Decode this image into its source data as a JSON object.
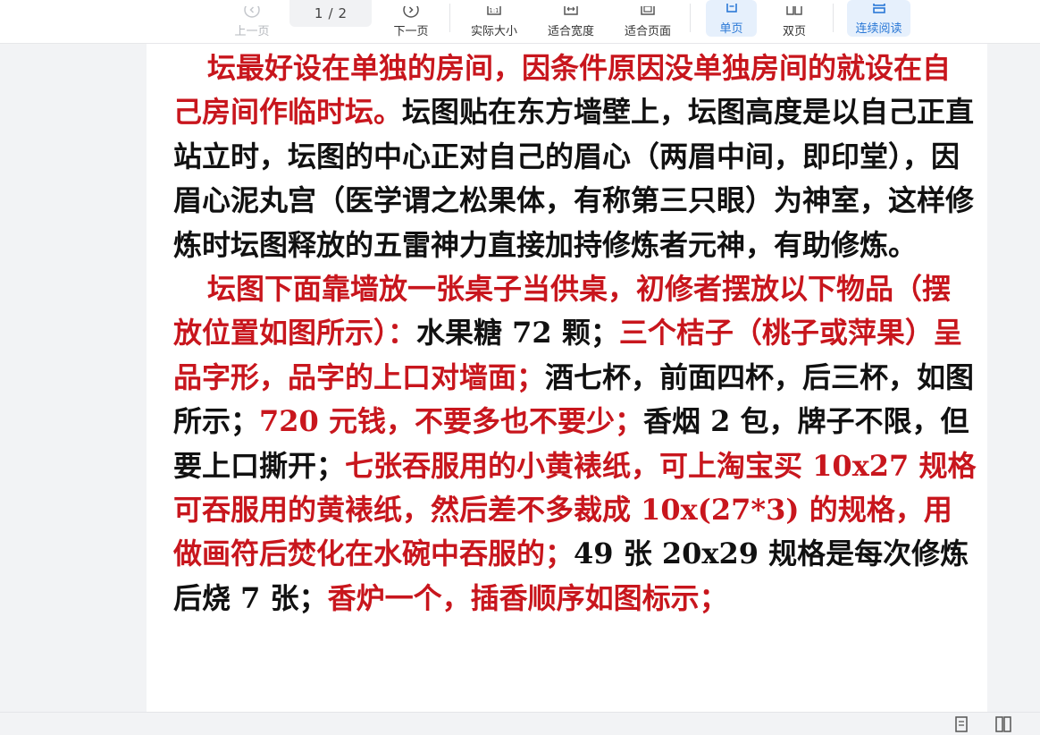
{
  "toolbar": {
    "prev_page": "上一页",
    "page_current": "1",
    "page_separator": "/",
    "page_total": "2",
    "next_page": "下一页",
    "actual_size": "实际大小",
    "fit_width": "适合宽度",
    "fit_page": "适合页面",
    "single_page": "单页",
    "double_page": "双页",
    "continuous_read": "连续阅读"
  },
  "colors": {
    "accent": "#2a78d6",
    "active_bg": "#e6f0fc",
    "text_red": "#c8161d",
    "text_black": "#111111"
  },
  "document": {
    "para1": {
      "r1": "坛最好设在单独的房间，因条件原因没单独房间的就设在自己房间作临时坛。",
      "b1": "坛图贴在东方墙壁上，坛图高度是以自己正直站立时，坛图的中心正对自己的眉心（两眉中间，即印堂），因眉心泥丸宫（医学谓之松果体，有称第三只眼）为神室，这样修炼时坛图释放的五雷神力直接加持修炼者元神，有助修炼。"
    },
    "para2": {
      "r1": "坛图下面靠墙放一张桌子当供桌，初修者摆放以下物品（摆放位置如图所示）：",
      "b1": "水果糖 72 颗；",
      "r2": "三个桔子（桃子或萍果）呈品字形，品字的上口对墙面；",
      "b2": "酒七杯，前面四杯，后三杯，如图所示；",
      "r3": "720 元钱，不要多也不要少；",
      "b3": "香烟 2 包，牌子不限，但要上口撕开；",
      "r4": "七张吞服用的小黄裱纸，可上淘宝买 10x27 规格可吞服用的黄裱纸，然后差不多裁成 10x(27*3) 的规格，用做画符后焚化在水碗中吞服的；",
      "b4": "49 张 20x29 规格是每次修炼后烧 7 张；",
      "r5": "香炉一个，插香顺序如图标示；"
    }
  },
  "statusbar": {
    "icons": [
      "single-page-view-icon",
      "double-page-view-icon"
    ]
  }
}
